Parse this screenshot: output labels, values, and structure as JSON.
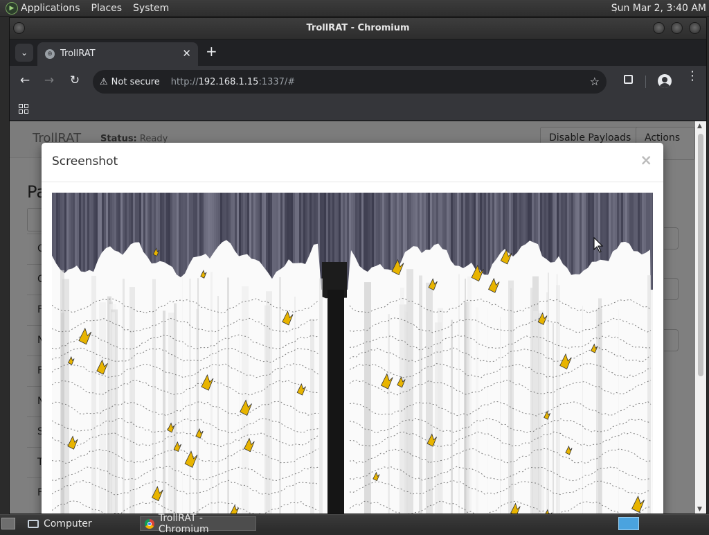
{
  "top_panel": {
    "menus": [
      "Applications",
      "Places",
      "System"
    ],
    "clock": "Sun Mar 2,  3:40 AM"
  },
  "window": {
    "title": "TrollRAT - Chromium"
  },
  "browser": {
    "tab": {
      "title": "TrollRAT"
    },
    "omnibox": {
      "security_label": "Not secure",
      "url_prefix": "http://",
      "url_host": "192.168.1.15",
      "url_rest": ":1337/#"
    }
  },
  "page": {
    "brand": "TrollRAT",
    "status_label": "Status:",
    "status_value": "Ready",
    "disable_payloads_label": "Disable Payloads",
    "actions_label": "Actions",
    "heading_partial": "Pa",
    "row_initials": [
      "C",
      "C",
      "F",
      "N",
      "F",
      "N",
      "S",
      "T",
      "F"
    ]
  },
  "modal": {
    "title": "Screenshot",
    "close_glyph": "×"
  },
  "taskbar": {
    "tasks": [
      "Computer",
      "TrollRAT - Chromium"
    ]
  },
  "colors": {
    "accent_chrome_dark": "#35363a",
    "glitch_yellow": "#e8b400"
  },
  "icons": {
    "back": "arrow-left-icon",
    "forward": "arrow-right-icon",
    "reload": "reload-icon",
    "warning": "warning-triangle-icon",
    "star": "star-icon",
    "extensions": "puzzle-icon",
    "profile": "account-icon",
    "menu": "kebab-menu-icon",
    "apps": "apps-grid-icon"
  }
}
